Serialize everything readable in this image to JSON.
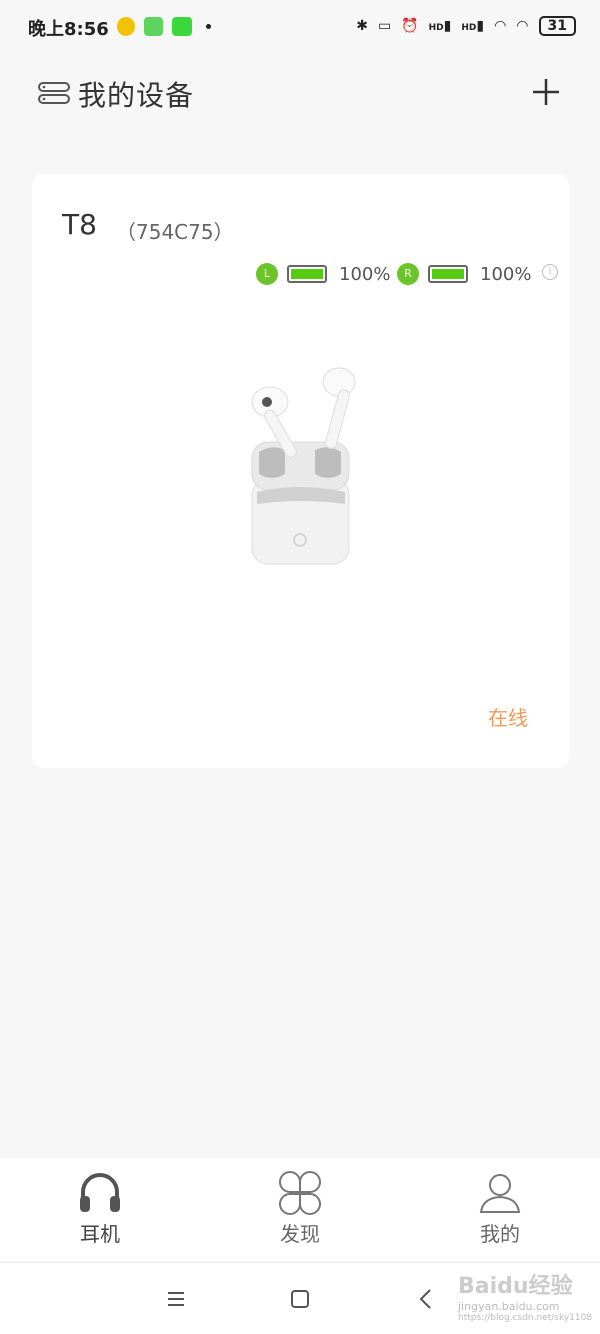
{
  "status_bar": {
    "time": "晚上8:56",
    "battery_level": "31",
    "hd1": "HD",
    "hd2": "HD"
  },
  "header": {
    "title": "我的设备"
  },
  "device": {
    "name": "T8",
    "id": "（754C75）",
    "left_label": "L",
    "left_battery": "100%",
    "right_label": "R",
    "right_battery": "100%",
    "status": "在线"
  },
  "tabs": [
    {
      "label": "耳机",
      "icon": "headphones-icon",
      "active": true
    },
    {
      "label": "发现",
      "icon": "clover-icon",
      "active": false
    },
    {
      "label": "我的",
      "icon": "person-icon",
      "active": false
    }
  ],
  "watermark": {
    "brand": "Baidu经验",
    "site": "jingyan.baidu.com",
    "url": "https://blog.csdn.net/sky1108"
  },
  "colors": {
    "accent_green": "#6bc42a",
    "status_orange": "#f09a5a",
    "background": "#f7f7f7"
  }
}
